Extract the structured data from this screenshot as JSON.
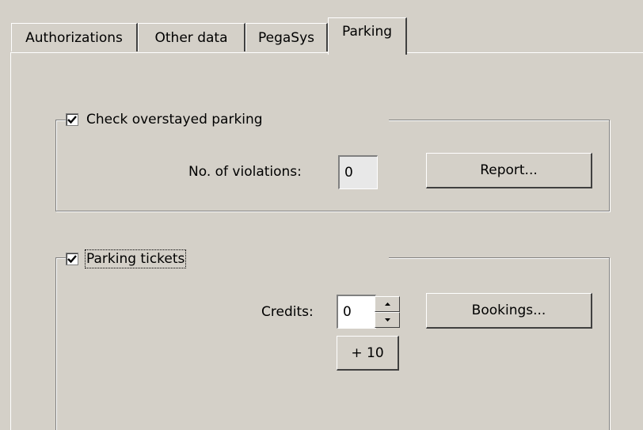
{
  "tabs": [
    {
      "label": "Authorizations"
    },
    {
      "label": "Other data"
    },
    {
      "label": "PegaSys"
    },
    {
      "label": "Parking",
      "active": true
    }
  ],
  "overstayed": {
    "title": "Check overstayed parking",
    "checked": true,
    "violations_label": "No. of violations:",
    "violations_value": "0",
    "report_button": "Report..."
  },
  "tickets": {
    "title": "Parking tickets",
    "checked": true,
    "credits_label": "Credits:",
    "credits_value": "0",
    "bookings_button": "Bookings...",
    "plus_button": "+ 10"
  },
  "icons": [
    "checkmark-icon",
    "spin-up-icon",
    "spin-down-icon"
  ]
}
